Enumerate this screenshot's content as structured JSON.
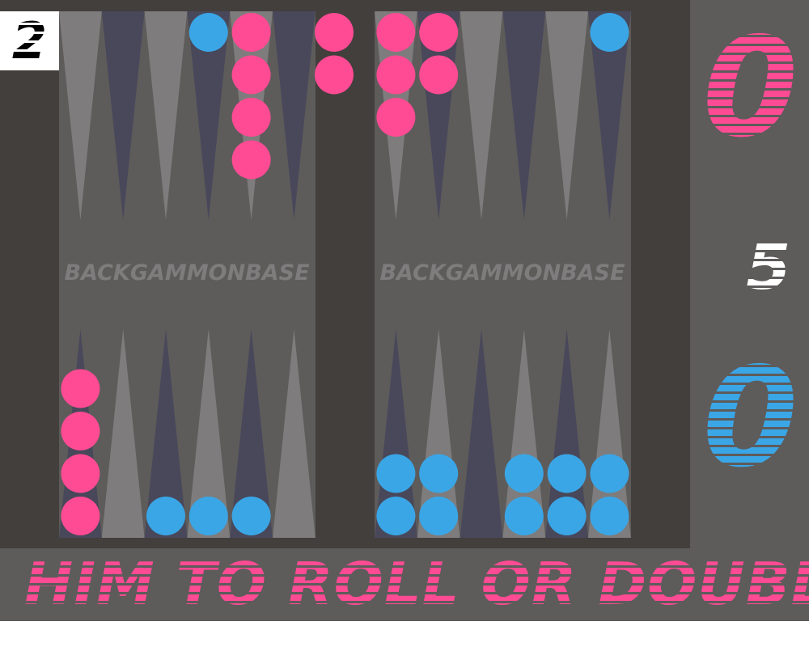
{
  "game": {
    "watermark": "BACKGAMMONBASE",
    "status": "HIM TO ROLL OR DOUBLE.",
    "cube_value": "2",
    "score_top": "0",
    "score_bottom": "0",
    "match_length": "5"
  },
  "colors": {
    "background": "#5e5b5b",
    "frame": "#433f3d",
    "half_board": "#5e5b5b",
    "point_light": "#7e7c7c",
    "point_dark": "#48485a",
    "checker_pink": "#ff4b93",
    "checker_blue": "#3aa6e6",
    "watermark": "#7e7c7c"
  },
  "points_top_left": [
    {
      "col": 0,
      "shade": "light"
    },
    {
      "col": 1,
      "shade": "dark"
    },
    {
      "col": 2,
      "shade": "light"
    },
    {
      "col": 3,
      "shade": "dark"
    },
    {
      "col": 4,
      "shade": "light"
    },
    {
      "col": 5,
      "shade": "dark"
    }
  ],
  "points_top_right": [
    {
      "col": 0,
      "shade": "light"
    },
    {
      "col": 1,
      "shade": "dark"
    },
    {
      "col": 2,
      "shade": "light"
    },
    {
      "col": 3,
      "shade": "dark"
    },
    {
      "col": 4,
      "shade": "light"
    },
    {
      "col": 5,
      "shade": "dark"
    }
  ],
  "points_bottom_left": [
    {
      "col": 0,
      "shade": "dark"
    },
    {
      "col": 1,
      "shade": "light"
    },
    {
      "col": 2,
      "shade": "dark"
    },
    {
      "col": 3,
      "shade": "light"
    },
    {
      "col": 4,
      "shade": "dark"
    },
    {
      "col": 5,
      "shade": "light"
    }
  ],
  "points_bottom_right": [
    {
      "col": 0,
      "shade": "dark"
    },
    {
      "col": 1,
      "shade": "light"
    },
    {
      "col": 2,
      "shade": "dark"
    },
    {
      "col": 3,
      "shade": "light"
    },
    {
      "col": 4,
      "shade": "dark"
    },
    {
      "col": 5,
      "shade": "light"
    }
  ],
  "stacks": [
    {
      "half": "left",
      "row": "top",
      "col": 3,
      "color": "blue",
      "count": 1
    },
    {
      "half": "left",
      "row": "top",
      "col": 4,
      "color": "pink",
      "count": 4
    },
    {
      "half": "bar",
      "row": "top",
      "col": 0,
      "color": "pink",
      "count": 2
    },
    {
      "half": "right",
      "row": "top",
      "col": 0,
      "color": "pink",
      "count": 3
    },
    {
      "half": "right",
      "row": "top",
      "col": 1,
      "color": "pink",
      "count": 2
    },
    {
      "half": "right",
      "row": "top",
      "col": 5,
      "color": "blue",
      "count": 1
    },
    {
      "half": "left",
      "row": "bottom",
      "col": 0,
      "color": "pink",
      "count": 4
    },
    {
      "half": "left",
      "row": "bottom",
      "col": 2,
      "color": "blue",
      "count": 1
    },
    {
      "half": "left",
      "row": "bottom",
      "col": 3,
      "color": "blue",
      "count": 1
    },
    {
      "half": "left",
      "row": "bottom",
      "col": 4,
      "color": "blue",
      "count": 1
    },
    {
      "half": "right",
      "row": "bottom",
      "col": 0,
      "color": "blue",
      "count": 2
    },
    {
      "half": "right",
      "row": "bottom",
      "col": 1,
      "color": "blue",
      "count": 2
    },
    {
      "half": "right",
      "row": "bottom",
      "col": 3,
      "color": "blue",
      "count": 2
    },
    {
      "half": "right",
      "row": "bottom",
      "col": 4,
      "color": "blue",
      "count": 2
    },
    {
      "half": "right",
      "row": "bottom",
      "col": 5,
      "color": "blue",
      "count": 2
    }
  ]
}
